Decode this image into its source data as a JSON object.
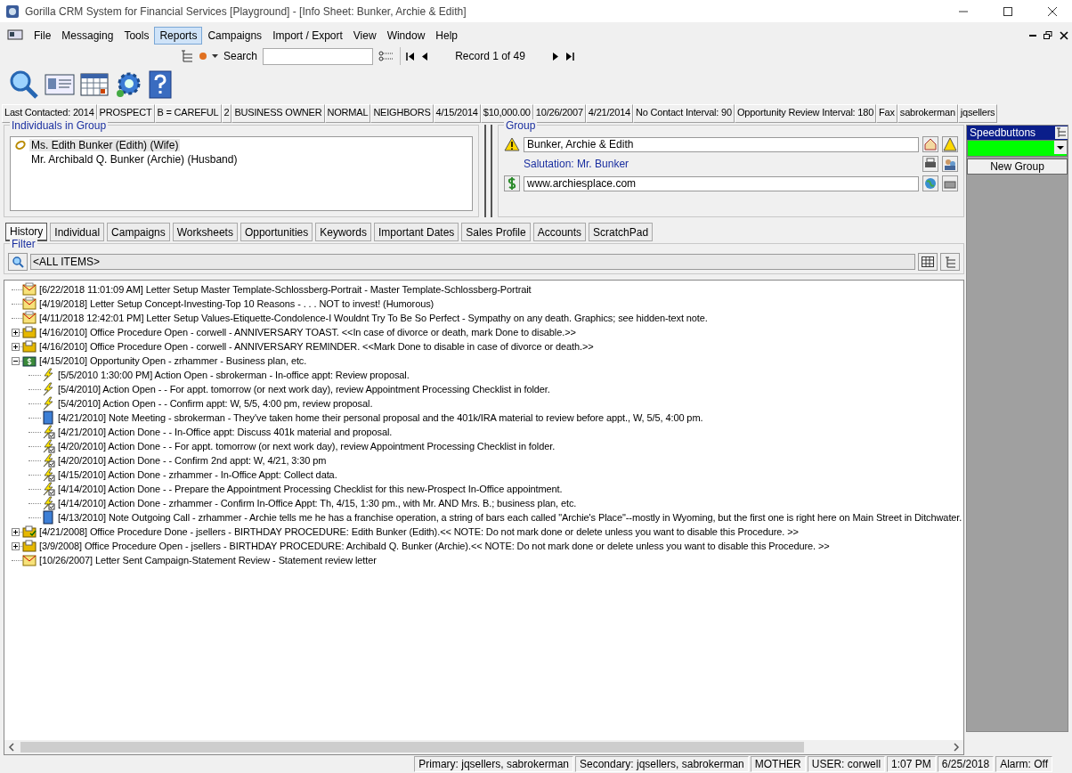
{
  "window": {
    "title": "Gorilla CRM System for Financial Services [Playground] - [Info Sheet:  Bunker, Archie & Edith]"
  },
  "menu": [
    {
      "label": "File",
      "selected": false
    },
    {
      "label": "Messaging",
      "selected": false
    },
    {
      "label": "Tools",
      "selected": false
    },
    {
      "label": "Reports",
      "selected": true
    },
    {
      "label": "Campaigns",
      "selected": false
    },
    {
      "label": "Import / Export",
      "selected": false
    },
    {
      "label": "View",
      "selected": false
    },
    {
      "label": "Window",
      "selected": false
    },
    {
      "label": "Help",
      "selected": false
    }
  ],
  "navigator": {
    "search_label": "Search",
    "record": "Record 1 of 49"
  },
  "info_bar": [
    "Last Contacted:  2014",
    "PROSPECT",
    "B = CAREFUL",
    "2",
    "BUSINESS OWNER",
    "NORMAL",
    "NEIGHBORS",
    "4/15/2014",
    "$10,000.00",
    "10/26/2007",
    "4/21/2014",
    "No Contact Interval:  90",
    "Opportunity Review Interval:  180",
    "Fax",
    "sabrokerman",
    "jqsellers"
  ],
  "individuals": {
    "title": "Individuals in Group",
    "items": [
      {
        "name": "Ms. Edith Bunker (Edith) (Wife)",
        "selected": true
      },
      {
        "name": "Mr. Archibald Q. Bunker (Archie) (Husband)",
        "selected": false
      }
    ]
  },
  "group": {
    "title": "Group",
    "name": "Bunker, Archie & Edith",
    "salutation": "Salutation:  Mr. Bunker",
    "website": "www.archiesplace.com"
  },
  "speedbuttons": {
    "title": "Speedbuttons",
    "buttons": [
      "New Group"
    ]
  },
  "tabs": [
    {
      "label": "History",
      "selected": true
    },
    {
      "label": "Individual",
      "selected": false
    },
    {
      "label": "Campaigns",
      "selected": false
    },
    {
      "label": "Worksheets",
      "selected": false
    },
    {
      "label": "Opportunities",
      "selected": false
    },
    {
      "label": "Keywords",
      "selected": false
    },
    {
      "label": "Important Dates",
      "selected": false
    },
    {
      "label": "Sales Profile",
      "selected": false
    },
    {
      "label": "Accounts",
      "selected": false
    },
    {
      "label": "ScratchPad",
      "selected": false
    }
  ],
  "filter": {
    "title": "Filter",
    "value": "<ALL ITEMS>"
  },
  "history": [
    {
      "kind": "letter",
      "text": "[6/22/2018 11:01:09 AM] Letter Setup Master Template-Schlossberg-Portrait - Master Template-Schlossberg-Portrait"
    },
    {
      "kind": "letter",
      "text": "[4/19/2018] Letter Setup Concept-Investing-Top 10 Reasons - . . . NOT to invest!  (Humorous)"
    },
    {
      "kind": "letter",
      "text": "[4/11/2018 12:42:01 PM] Letter Setup Values-Etiquette-Condolence-I Wouldnt Try To Be So Perfect - Sympathy on any death.  Graphics; see hidden-text note."
    },
    {
      "kind": "procedure",
      "expanded": false,
      "text": "[4/16/2010] Office Procedure Open - corwell - ANNIVERSARY TOAST.  <<In case of divorce or death, mark Done to disable.>>"
    },
    {
      "kind": "procedure",
      "expanded": false,
      "text": "[4/16/2010] Office Procedure Open - corwell - ANNIVERSARY REMINDER.  <<Mark Done to disable in case of divorce or death.>>"
    },
    {
      "kind": "opportunity",
      "expanded": true,
      "text": "[4/15/2010] Opportunity Open - zrhammer - Business plan, etc.",
      "children": [
        {
          "kind": "action",
          "text": "[5/5/2010 1:30:00 PM] Action Open - sbrokerman - In-office appt: Review proposal."
        },
        {
          "kind": "action",
          "text": "[5/4/2010] Action Open -  - For appt. tomorrow (or next work day), review Appointment Processing Checklist in folder."
        },
        {
          "kind": "action",
          "text": "[5/4/2010] Action Open -  - Confirm appt: W, 5/5, 4:00 pm, review proposal."
        },
        {
          "kind": "note",
          "text": "[4/21/2010] Note Meeting - sbrokerman - They've taken home their personal proposal and the 401k/IRA material to review before appt., W, 5/5, 4:00 pm."
        },
        {
          "kind": "action_done",
          "text": "[4/21/2010] Action Done -  - In-Office appt: Discuss 401k material and proposal."
        },
        {
          "kind": "action_done",
          "text": "[4/20/2010] Action Done -  - For appt. tomorrow (or next work day), review Appointment Processing Checklist in folder."
        },
        {
          "kind": "action_done",
          "text": "[4/20/2010] Action Done -  - Confirm 2nd appt: W, 4/21, 3:30 pm"
        },
        {
          "kind": "action_done",
          "text": "[4/15/2010] Action Done - zrhammer - In-Office Appt: Collect data."
        },
        {
          "kind": "action_done",
          "text": "[4/14/2010] Action Done -  - Prepare the Appointment Processing Checklist for this new-Prospect In-Office appointment."
        },
        {
          "kind": "action_done",
          "text": "[4/14/2010] Action Done - zrhammer - Confirm In-Office Appt: Th, 4/15, 1:30 pm., with Mr. AND Mrs. B.; business plan, etc."
        },
        {
          "kind": "note",
          "text": "[4/13/2010] Note Outgoing Call - zrhammer - Archie tells me he has a franchise operation, a string of bars each called \"Archie's Place\"--mostly in Wyoming, but the first one is right here on Main Street in Ditchwater."
        }
      ]
    },
    {
      "kind": "procedure_done",
      "expanded": false,
      "text": "[4/21/2008] Office Procedure Done - jsellers - BIRTHDAY PROCEDURE:  Edith Bunker (Edith).<< NOTE:  Do not mark done or delete unless you want to disable this Procedure. >>"
    },
    {
      "kind": "procedure",
      "expanded": false,
      "text": "[3/9/2008] Office Procedure Open - jsellers - BIRTHDAY PROCEDURE:  Archibald Q. Bunker (Archie).<< NOTE:  Do not mark done or delete unless you want to disable this Procedure. >>"
    },
    {
      "kind": "letter_sent",
      "text": "[10/26/2007] Letter Sent Campaign-Statement Review - Statement review letter"
    }
  ],
  "status_bar": [
    "Primary:  jqsellers, sabrokerman",
    "Secondary:  jqsellers, sabrokerman",
    "MOTHER",
    "USER:  corwell",
    "1:07 PM",
    "6/25/2018",
    "Alarm:  Off"
  ]
}
